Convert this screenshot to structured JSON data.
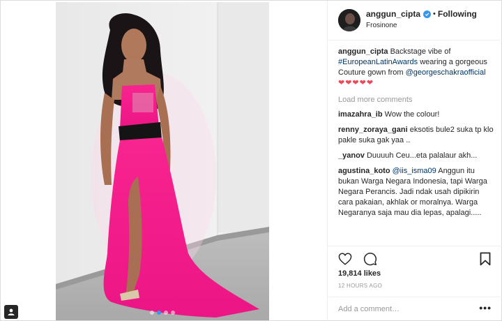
{
  "post": {
    "username": "anggun_cipta",
    "separator": "•",
    "follow_status": "Following",
    "location": "Frosinone",
    "carousel": {
      "count": 4,
      "active_index": 1
    }
  },
  "caption": {
    "username": "anggun_cipta",
    "text_before": " Backstage vibe of ",
    "hashtag": "#EuropeanLatinAwards",
    "text_middle": " wearing a gorgeous Couture gown from ",
    "mention": "@georgeschakraofficial",
    "hearts": "❤❤❤❤❤"
  },
  "load_more": "Load more comments",
  "comments": [
    {
      "username": "imazahra_ib",
      "text": " Wow the colour!"
    },
    {
      "username": "renny_zoraya_gani",
      "text": " eksotis bule2 suka tp klo pakle suka gak yaa .."
    },
    {
      "username": "_yanov",
      "text": " Duuuuh Ceu...eta palalaur akh..."
    },
    {
      "username": "agustina_koto",
      "mention": "@iis_isma09",
      "text": " Anggun itu bukan Warga Negara Indonesia, tapi Warga Negara Perancis. Jadi ndak usah dipikirin cara pakaian, akhlak or moralnya. Warga Negaranya saja mau dia lepas, apalagi....."
    }
  ],
  "likes": "19,814 likes",
  "time": "12 HOURS AGO",
  "add_comment_placeholder": "Add a comment…",
  "more_options": "•••",
  "icons": [
    "heart-icon",
    "comment-icon",
    "bookmark-icon",
    "verified-badge-icon",
    "more-options-icon",
    "user-tag-icon"
  ],
  "colors": {
    "accent": "#3897f0",
    "hashtag": "#003569",
    "hearts": "#ed4956",
    "muted": "#999999",
    "dress": "#f0148c"
  }
}
